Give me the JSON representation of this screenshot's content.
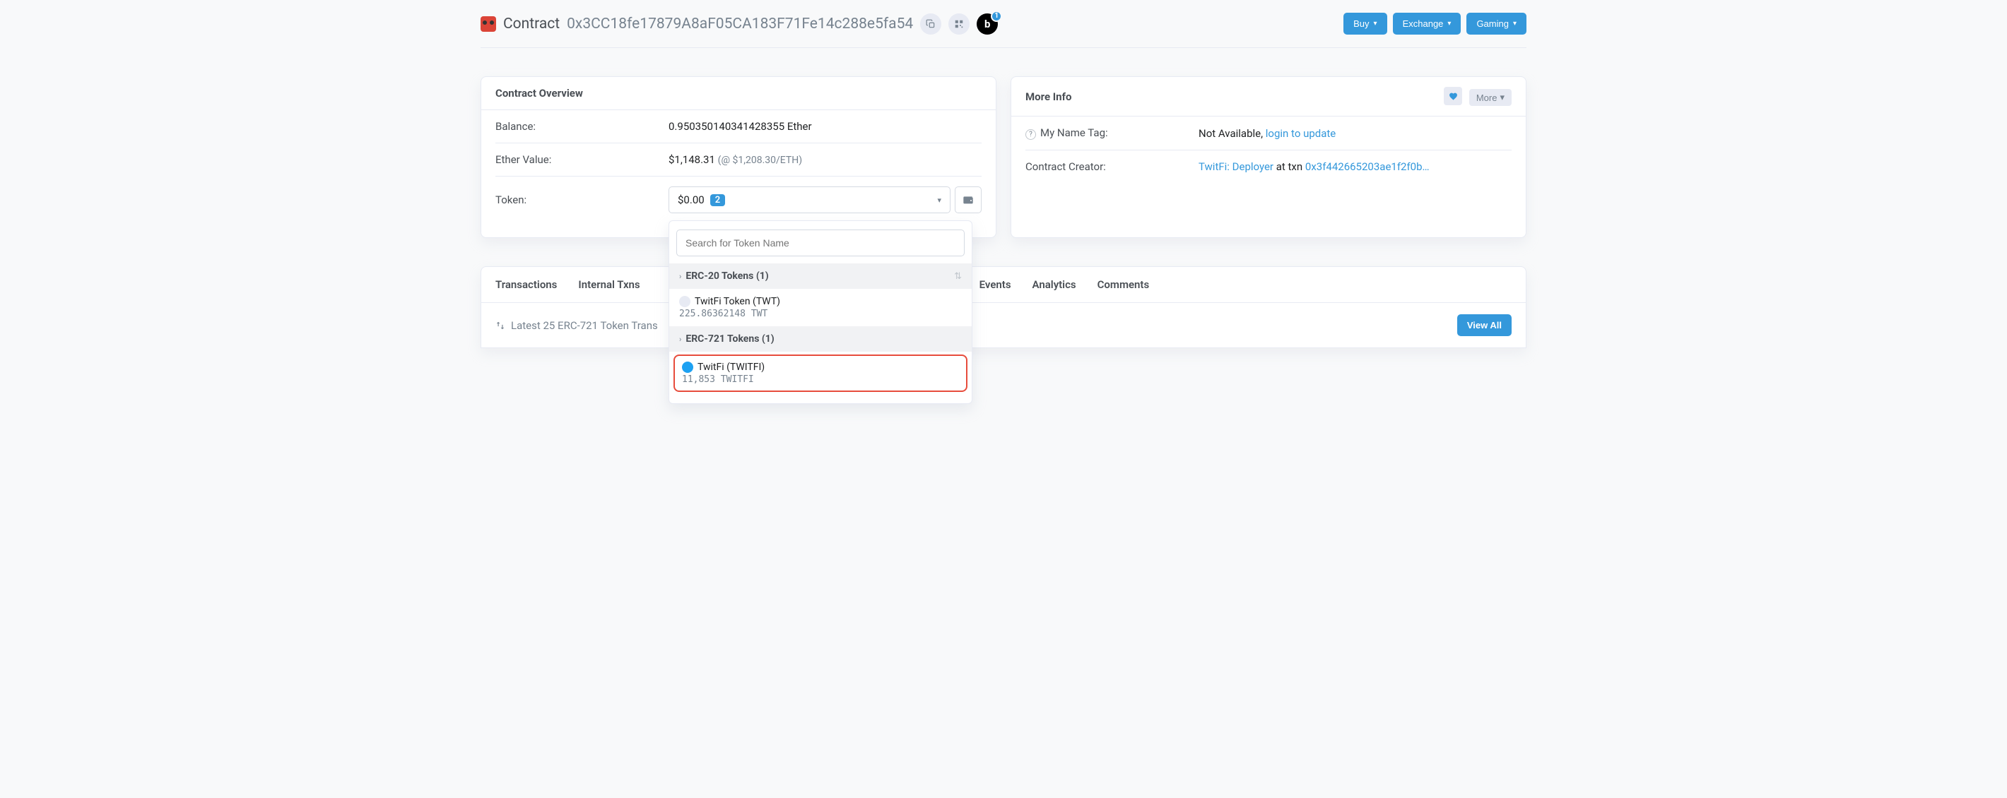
{
  "header": {
    "page_title": "Contract",
    "address": "0x3CC18fe17879A8aF05CA183F71Fe14c288e5fa54",
    "blockscan_badge": "1",
    "buttons": {
      "buy": "Buy",
      "exchange": "Exchange",
      "gaming": "Gaming"
    }
  },
  "overview": {
    "title": "Contract Overview",
    "balance_label": "Balance:",
    "balance_value": "0.950350140341428355 Ether",
    "ether_value_label": "Ether Value:",
    "ether_value": "$1,148.31",
    "ether_rate": "(@ $1,208.30/ETH)",
    "token_label": "Token:",
    "token_value": "$0.00",
    "token_count": "2"
  },
  "token_dropdown": {
    "search_placeholder": "Search for Token Name",
    "erc20_header": "ERC-20 Tokens (1)",
    "erc20_item_name": "TwitFi Token (TWT)",
    "erc20_item_amount": "225.86362148 TWT",
    "erc721_header": "ERC-721 Tokens (1)",
    "erc721_item_name": "TwitFi (TWITFI)",
    "erc721_item_amount": "11,853 TWITFI"
  },
  "more_info": {
    "title": "More Info",
    "more_button": "More",
    "name_tag_label": "My Name Tag:",
    "name_tag_value": "Not Available, ",
    "name_tag_link": "login to update",
    "creator_label": "Contract Creator:",
    "creator_name": "TwitFi: Deployer",
    "creator_at": " at txn ",
    "creator_txn": "0x3f442665203ae1f2f0b…"
  },
  "tabs": {
    "transactions": "Transactions",
    "internal": "Internal Txns",
    "events": "Events",
    "analytics": "Analytics",
    "comments": "Comments"
  },
  "tab_body": {
    "latest_text": "Latest 25 ERC-721 Token Trans",
    "view_all": "View All"
  }
}
